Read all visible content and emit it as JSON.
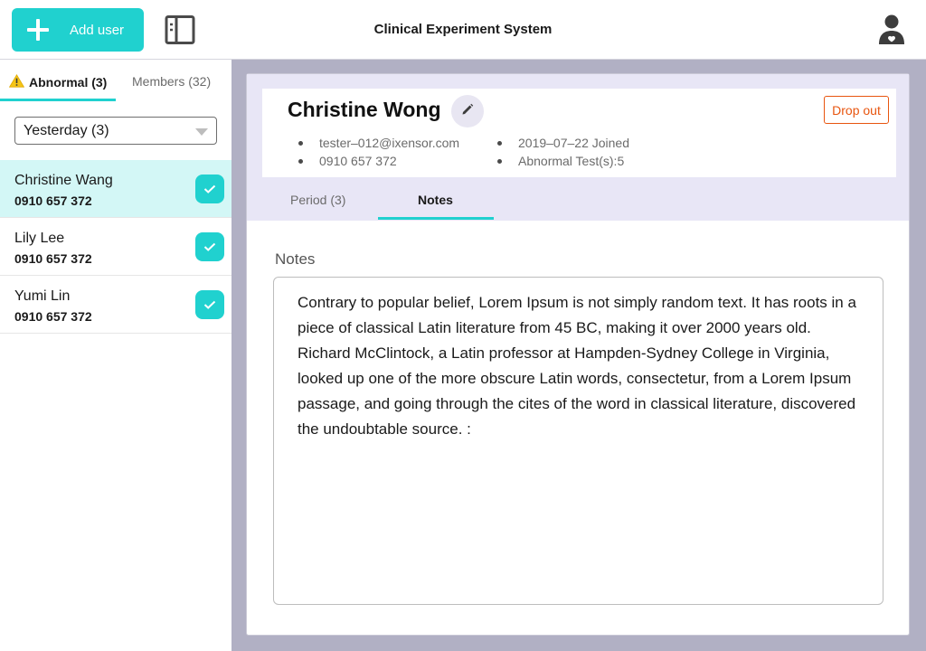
{
  "header": {
    "add_user_label": "Add user",
    "app_title": "Clinical Experiment System"
  },
  "sidebar": {
    "tabs": [
      {
        "label": "Abnormal (3)",
        "active": true
      },
      {
        "label": "Members (32)",
        "active": false
      }
    ],
    "filter": {
      "selected": "Yesterday (3)"
    },
    "users": [
      {
        "name": "Christine Wang",
        "phone": "0910 657 372",
        "selected": true
      },
      {
        "name": "Lily Lee",
        "phone": "0910 657 372",
        "selected": false
      },
      {
        "name": "Yumi Lin",
        "phone": "0910 657 372",
        "selected": false
      }
    ]
  },
  "profile": {
    "name": "Christine Wong",
    "email": "tester–012@ixensor.com",
    "phone": "0910 657 372",
    "joined": "2019–07–22 Joined",
    "abnormal_tests": "Abnormal Test(s):5",
    "dropout_label": "Drop out"
  },
  "content_tabs": [
    {
      "label": "Period (3)",
      "active": false
    },
    {
      "label": "Notes",
      "active": true
    }
  ],
  "notes": {
    "label": "Notes",
    "text": "Contrary to popular belief, Lorem Ipsum is not simply random text. It has roots in a piece of classical Latin literature from 45 BC, making it over 2000 years old. Richard McClintock, a Latin professor at Hampden-Sydney College in Virginia, looked up one of the more obscure Latin words, consectetur, from a Lorem Ipsum passage, and going through the cites of the word in classical literature, discovered the undoubtable source. :"
  },
  "colors": {
    "accent": "#20d1cf",
    "danger": "#e8550f",
    "background": "#b1b0c4",
    "header_zone": "#e8e6f6",
    "selected_row": "#d3f7f6"
  },
  "icons": {
    "add": "plus-icon",
    "panel": "panel-toggle-icon",
    "avatar": "user-avatar-icon",
    "warning": "warning-icon",
    "check": "check-icon",
    "edit": "pencil-icon",
    "dropdown": "caret-down-icon"
  }
}
